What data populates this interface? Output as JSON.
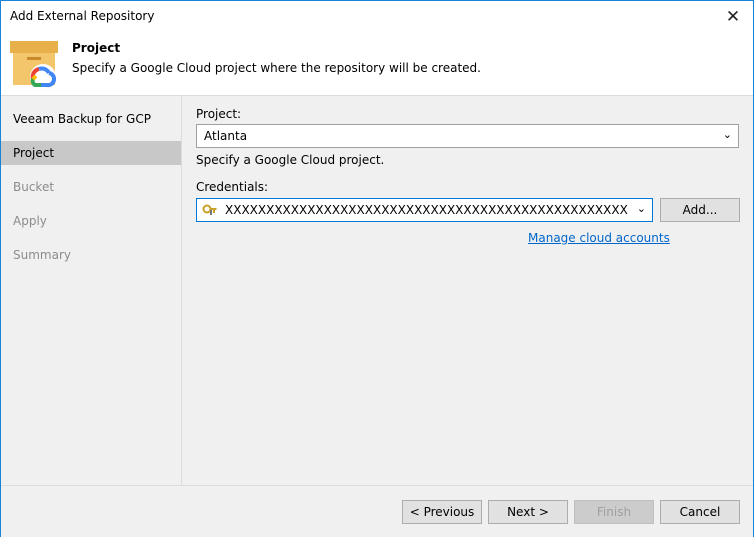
{
  "window": {
    "title": "Add External Repository",
    "close_glyph": "✕"
  },
  "header": {
    "title": "Project",
    "description": "Specify a Google Cloud project where the repository will be created.",
    "icon": "google-cloud-repository-icon"
  },
  "steps": [
    {
      "label": "Veeam Backup for GCP",
      "state": "done"
    },
    {
      "label": "Project",
      "state": "active"
    },
    {
      "label": "Bucket",
      "state": "pending"
    },
    {
      "label": "Apply",
      "state": "pending"
    },
    {
      "label": "Summary",
      "state": "pending"
    }
  ],
  "form": {
    "project_label": "Project:",
    "project_value": "Atlanta",
    "project_hint": "Specify a Google Cloud project.",
    "credentials_label": "Credentials:",
    "credentials_value": "XXXXXXXXXXXXXXXXXXXXXXXXXXXXXXXXXXXXXXXXXXXXXXXXX (last edited",
    "credentials_icon": "key-icon",
    "add_button": "Add...",
    "manage_link": "Manage cloud accounts"
  },
  "footer": {
    "previous": "< Previous",
    "next": "Next >",
    "finish": "Finish",
    "cancel": "Cancel"
  },
  "colors": {
    "accent": "#0078d7",
    "link": "#0066cc",
    "active_step": "#c8c8c8"
  }
}
